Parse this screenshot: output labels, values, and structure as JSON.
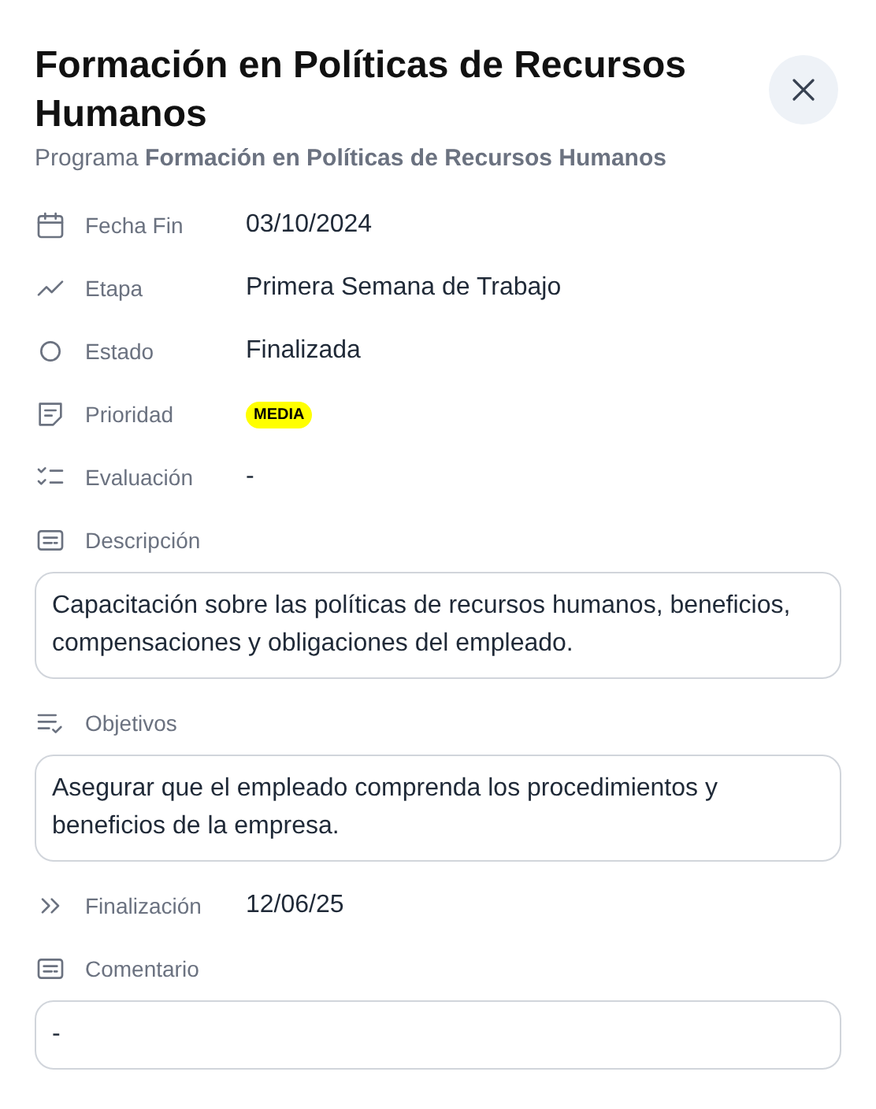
{
  "title": "Formación en Políticas de Recursos Humanos",
  "subtitle": "Programa **Formación en Políticas de Recursos Humanos**",
  "fields": [
    {
      "kind": "field",
      "label": "Fecha Fin",
      "value": "03/10/2024"
    },
    {
      "kind": "field",
      "label": "Etapa",
      "value": "Primera Semana de Trabajo"
    },
    {
      "kind": "field",
      "label": "Estado",
      "value": "Finalizada"
    },
    {
      "kind": "badge",
      "label": "Prioridad",
      "value": "MEDIA"
    },
    {
      "kind": "field",
      "label": "Evaluación",
      "value": "-"
    },
    {
      "kind": "textbox",
      "label": "Descripción",
      "value": "Capacitación sobre las políticas de recursos humanos, beneficios, compensaciones y obligaciones del empleado."
    },
    {
      "kind": "textbox",
      "label": "Objetivos",
      "value": "Asegurar que el empleado comprenda los procedimientos y beneficios de la empresa."
    },
    {
      "kind": "field",
      "label": "Finalización",
      "value": "12/06/25"
    },
    {
      "kind": "textbox",
      "label": "Comentario",
      "value": "-"
    }
  ]
}
